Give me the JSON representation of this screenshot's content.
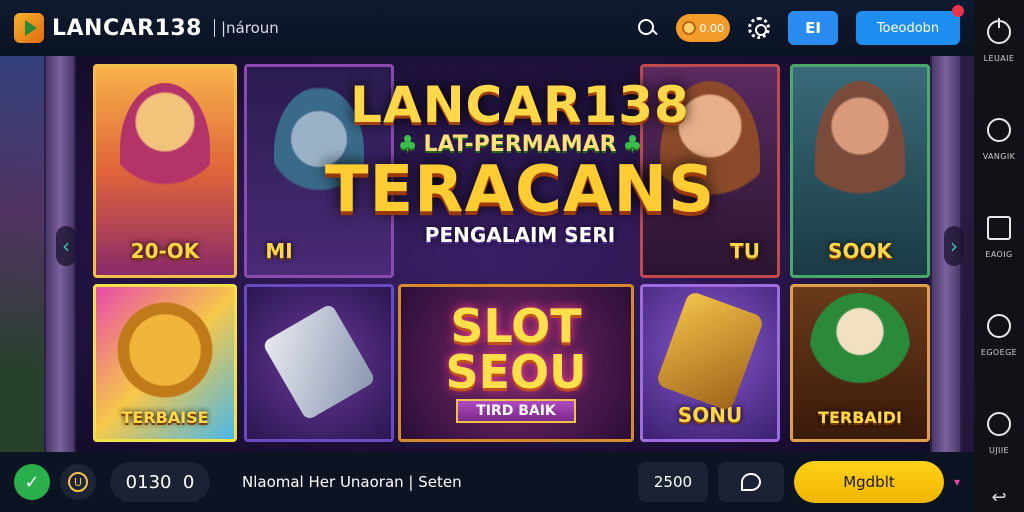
{
  "header": {
    "brand": "LANCAR138",
    "sub_label": "|nároun",
    "coin_value": "0.00",
    "menu_icon_label": "EI",
    "login_label": "Toeodobn"
  },
  "sidebar": {
    "items": [
      {
        "label": "LEUAIE",
        "icon": "power-icon"
      },
      {
        "label": "VANGIK",
        "icon": "chat-icon"
      },
      {
        "label": "EAOIG",
        "icon": "box-icon"
      },
      {
        "label": "EGOEGE",
        "icon": "refresh-icon"
      },
      {
        "label": "UJIIE",
        "icon": "clock-icon"
      }
    ]
  },
  "banner": {
    "line1": "LANCAR138",
    "line2": "LAT-PERMAMAR",
    "line3": "TERACANS",
    "line4": "PENGALAIM SERI"
  },
  "tiles": [
    {
      "label": "20-OK"
    },
    {
      "label": "MI"
    },
    {
      "label": "TU"
    },
    {
      "label": "SOOK"
    },
    {
      "label": "TERBAISE"
    },
    {
      "label": ""
    },
    {
      "title1": "SLOT",
      "title2": "SEOU",
      "sub": "TIRD BAIK"
    },
    {
      "label": "SONU"
    },
    {
      "label": "TERBAIDI"
    }
  ],
  "footer": {
    "counter_left": "0130",
    "counter_right": "0",
    "ticker": "Nlaomal Her Unaoran | Seten",
    "bet_value": "2500",
    "spin_label": "Mgdblt"
  }
}
